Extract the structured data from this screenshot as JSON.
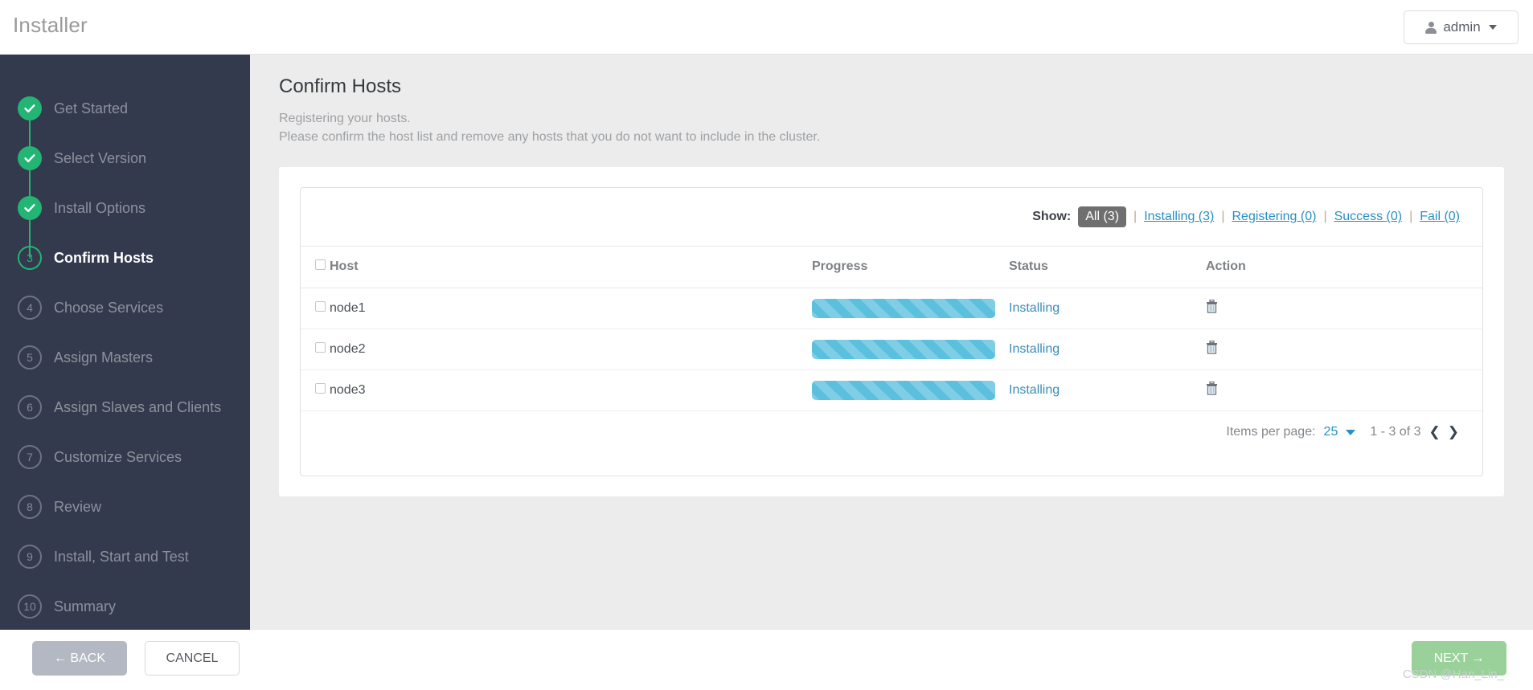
{
  "header": {
    "app_title": "Installer",
    "user_menu": {
      "label": "admin",
      "icon": "user-icon"
    }
  },
  "sidebar": {
    "steps": [
      {
        "num": "",
        "label": "Get Started",
        "state": "done"
      },
      {
        "num": "",
        "label": "Select Version",
        "state": "done"
      },
      {
        "num": "",
        "label": "Install Options",
        "state": "done"
      },
      {
        "num": "3",
        "label": "Confirm Hosts",
        "state": "current"
      },
      {
        "num": "4",
        "label": "Choose Services",
        "state": "todo"
      },
      {
        "num": "5",
        "label": "Assign Masters",
        "state": "todo"
      },
      {
        "num": "6",
        "label": "Assign Slaves and Clients",
        "state": "todo"
      },
      {
        "num": "7",
        "label": "Customize Services",
        "state": "todo"
      },
      {
        "num": "8",
        "label": "Review",
        "state": "todo"
      },
      {
        "num": "9",
        "label": "Install, Start and Test",
        "state": "todo"
      },
      {
        "num": "10",
        "label": "Summary",
        "state": "todo"
      }
    ]
  },
  "main": {
    "title": "Confirm Hosts",
    "subtitle_line1": "Registering your hosts.",
    "subtitle_line2": "Please confirm the host list and remove any hosts that you do not want to include in the cluster.",
    "filters": {
      "label": "Show:",
      "separator": "|",
      "items": [
        {
          "label": "All (3)",
          "active": true
        },
        {
          "label": "Installing (3)",
          "active": false
        },
        {
          "label": "Registering (0)",
          "active": false
        },
        {
          "label": "Success (0)",
          "active": false
        },
        {
          "label": "Fail (0)",
          "active": false
        }
      ]
    },
    "table": {
      "columns": [
        "Host",
        "Progress",
        "Status",
        "Action"
      ],
      "rows": [
        {
          "host": "node1",
          "progress": 100,
          "status": "Installing",
          "action_icon": "trash-icon",
          "checked": false
        },
        {
          "host": "node2",
          "progress": 100,
          "status": "Installing",
          "action_icon": "trash-icon",
          "checked": false
        },
        {
          "host": "node3",
          "progress": 100,
          "status": "Installing",
          "action_icon": "trash-icon",
          "checked": false
        }
      ]
    },
    "pagination": {
      "items_per_page_label": "Items per page:",
      "items_per_page_value": "25",
      "range": "1 - 3 of 3",
      "prev_icon": "chevron-left-icon",
      "next_icon": "chevron-right-icon"
    }
  },
  "footer": {
    "back_label": "← BACK",
    "cancel_label": "CANCEL",
    "next_label": "NEXT →"
  },
  "watermark": {
    "text": "CSDN @Han_Lin_"
  },
  "colors": {
    "sidebar_bg": "#343a4d",
    "accent_green": "#22b573",
    "link_blue": "#2a8fc4",
    "progress_blue": "#5bc0de",
    "next_green": "#9ad19a"
  }
}
